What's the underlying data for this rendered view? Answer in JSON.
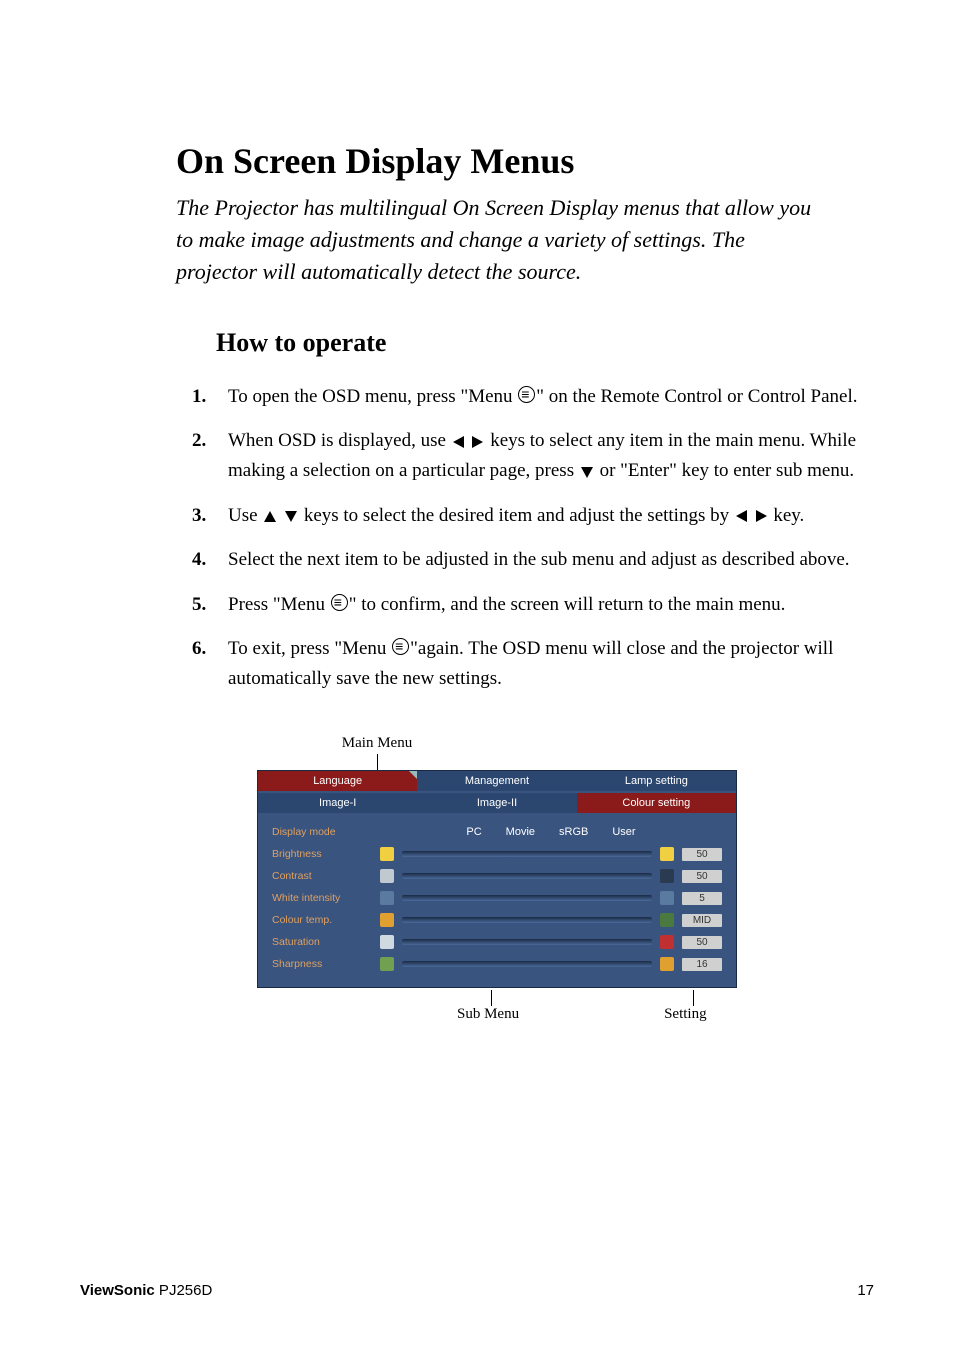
{
  "title": "On Screen Display Menus",
  "intro": "The Projector has multilingual On Screen Display menus that allow you to make image adjustments and change a variety of settings. The projector will automatically detect the source.",
  "howto_heading": "How to operate",
  "steps": {
    "s1a": "To open the OSD menu, press \"Menu ",
    "s1b": "\" on the Remote Control or Control Panel.",
    "s2a": "When OSD is displayed, use ",
    "s2b": " keys to select any item in the main menu.  While making a selection on a particular page, press ",
    "s2c": " or \"Enter\" key to enter sub menu.",
    "s3a": "Use ",
    "s3b": " keys to select the desired item and adjust the settings by ",
    "s3c": " key.",
    "s4": "Select the next item to be adjusted in the sub menu and adjust as described above.",
    "s5a": "Press \"Menu ",
    "s5b": "\" to confirm, and the screen will return to the main menu.",
    "s6a": "To exit, press \"Menu ",
    "s6b": "\"again.  The OSD menu will close and the projector will automatically save the new settings."
  },
  "osd": {
    "label_main": "Main Menu",
    "label_sub": "Sub Menu",
    "label_setting": "Setting",
    "tabs_top": [
      "Language",
      "Management",
      "Lamp setting"
    ],
    "tabs_bottom": [
      "Image-I",
      "Image-II",
      "Colour setting"
    ],
    "modes": [
      "PC",
      "Movie",
      "sRGB",
      "User"
    ],
    "rows": [
      {
        "label": "Display mode"
      },
      {
        "label": "Brightness",
        "value": "50",
        "c1": "#f0d040",
        "c2": "#f0d040"
      },
      {
        "label": "Contrast",
        "value": "50",
        "c1": "#c0c8d0",
        "c2": "#2a3a50"
      },
      {
        "label": "White intensity",
        "value": "5",
        "c1": "#5a7aa0",
        "c2": "#5a7aa0"
      },
      {
        "label": "Colour temp.",
        "value": "MID",
        "c1": "#e0a030",
        "c2": "#4a7a40"
      },
      {
        "label": "Saturation",
        "value": "50",
        "c1": "#d0d8e0",
        "c2": "#c03030"
      },
      {
        "label": "Sharpness",
        "value": "16",
        "c1": "#70a050",
        "c2": "#e0a030"
      }
    ]
  },
  "footer": {
    "brand": "ViewSonic",
    "model": " PJ256D",
    "page": "17"
  }
}
